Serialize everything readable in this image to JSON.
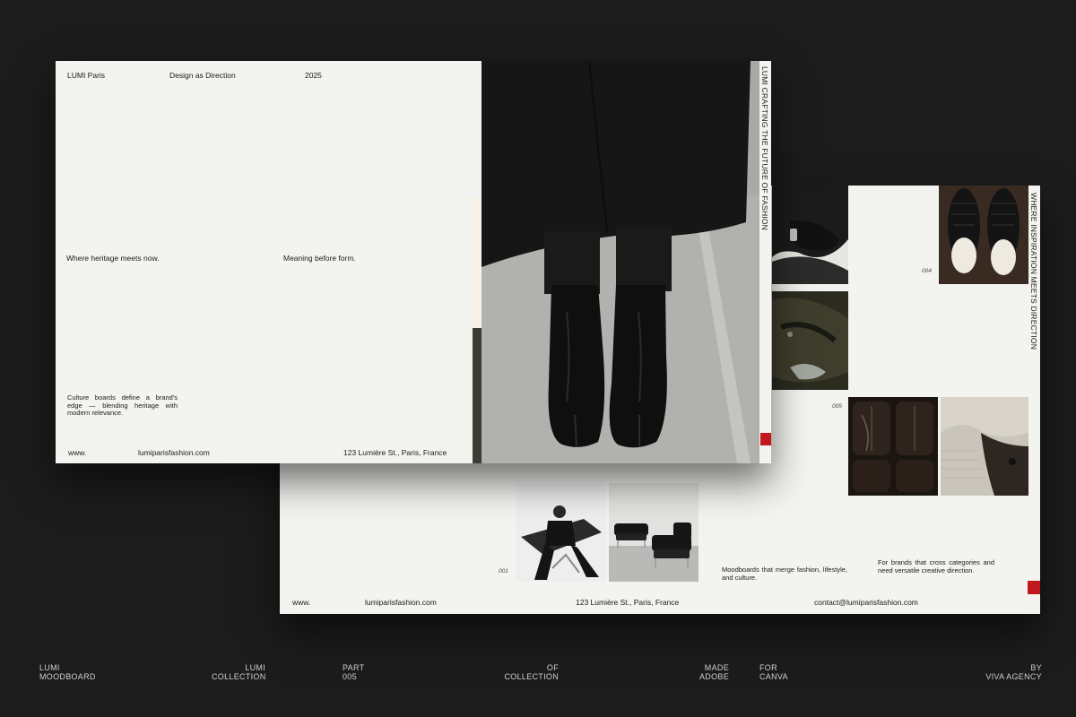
{
  "colors": {
    "background": "#1c1c1c",
    "paper": "#f3f3ef",
    "accent_red": "#c0181d",
    "olive": "#3c3c34",
    "cream": "#f7f4e6"
  },
  "back_page": {
    "vertical_text": "WHERE INSPIRATION MEETS DIRECTION",
    "numbers": {
      "n001": "001",
      "n004": "004",
      "n005": "005"
    },
    "text_moodboards": "Moodboards that merge fashion, lifestyle, and culture.",
    "text_brands": "For brands that cross categories and need versatile creative direction.",
    "footer": {
      "www": "www.",
      "site": "lumiparisfashion.com",
      "address": "123 Lumière St., Paris, France",
      "email": "contact@lumiparisfashion.com"
    }
  },
  "front_page": {
    "brand": "LUMI Paris",
    "tagline": "Design as Direction",
    "year": "2025",
    "text_heritage": "Where heritage meets now.",
    "text_meaning": "Meaning before form.",
    "text_culture": "Culture boards define a brand's edge — blending heritage with modern relevance.",
    "vertical_text": "LUMI CRAFTING THE FUTURE OF FASHION",
    "footer": {
      "www": "www.",
      "site": "lumiparisfashion.com",
      "address": "123 Lumière St., Paris, France"
    }
  },
  "bottom_bar": {
    "moodboard": {
      "line1": "LUMI",
      "line2": "MOODBOARD"
    },
    "collection": {
      "line1": "LUMI",
      "line2": "COLLECTION"
    },
    "part": {
      "line1": "PART",
      "line2": "005"
    },
    "of": {
      "line1": "OF",
      "line2": "COLLECTION"
    },
    "made": {
      "line1": "MADE",
      "line2": "ADOBE"
    },
    "for": {
      "line1": "FOR",
      "line2": "CANVA"
    },
    "by": {
      "line1": "BY",
      "line2": "VIVA AGENCY"
    }
  },
  "icons": [
    "boots-photo",
    "leather-gloves-photo",
    "croc-slippers-photo",
    "leather-bag-photo",
    "leather-sofa-photo",
    "knit-fabric-photo",
    "model-chair-photo",
    "lounge-chairs-photo"
  ]
}
